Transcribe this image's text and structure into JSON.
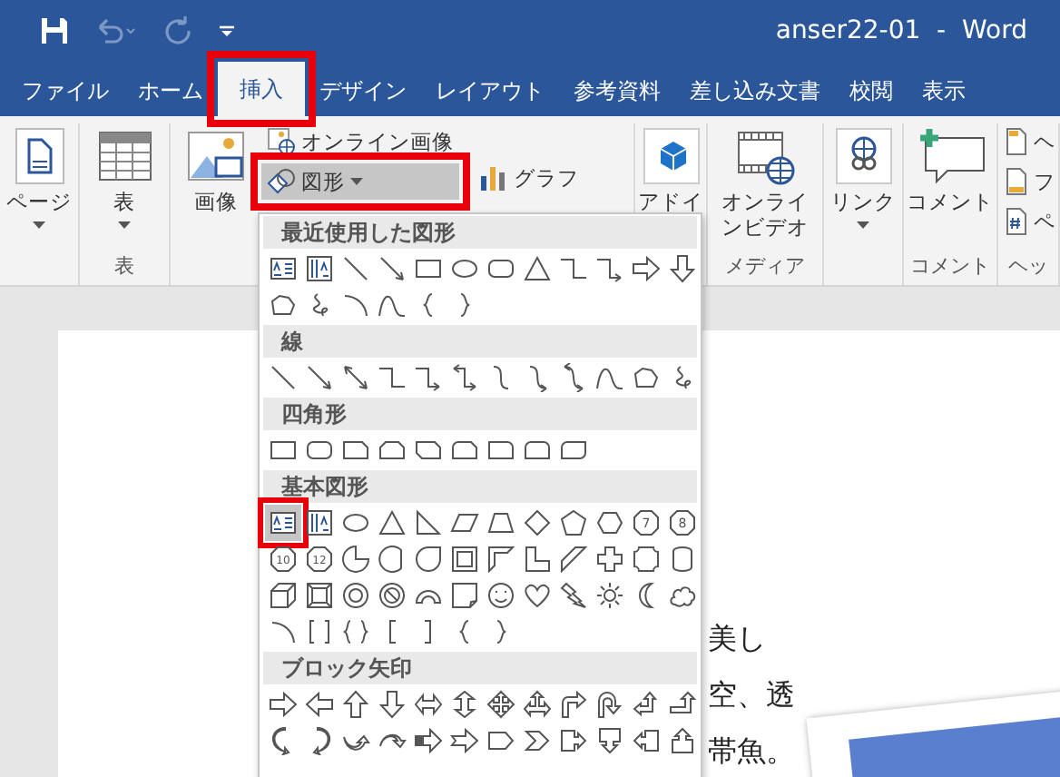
{
  "window": {
    "title": "anser22-01  -  Word"
  },
  "tabs": [
    {
      "label": "ファイル",
      "selected": false
    },
    {
      "label": "ホーム",
      "selected": false
    },
    {
      "label": "挿入",
      "selected": true
    },
    {
      "label": "デザイン",
      "selected": false
    },
    {
      "label": "レイアウト",
      "selected": false
    },
    {
      "label": "参考資料",
      "selected": false
    },
    {
      "label": "差し込み文書",
      "selected": false
    },
    {
      "label": "校閲",
      "selected": false
    },
    {
      "label": "表示",
      "selected": false
    }
  ],
  "ribbon": {
    "groups": [
      {
        "columns": [
          [
            {
              "kind": "page",
              "label": "ページ",
              "caret": true,
              "expanded": false
            }
          ]
        ]
      },
      {
        "label": "表",
        "columns": [
          [
            {
              "kind": "table",
              "label": "表",
              "caret": true,
              "expanded": false
            }
          ]
        ]
      },
      {
        "columns": [
          [
            {
              "kind": "picture",
              "label": "画像",
              "caret": false,
              "expanded": false
            }
          ],
          [
            {
              "kind": "online-picture",
              "label": "オンライン画像",
              "caret": false,
              "expanded": false
            },
            {
              "kind": "shapes",
              "label": "図形",
              "caret": true,
              "expanded": true
            }
          ],
          [
            {
              "kind": "chart",
              "label": "グラフ",
              "caret": false,
              "expanded": false
            }
          ]
        ]
      },
      {
        "columns": [
          [
            {
              "kind": "addin",
              "label": "アドイ",
              "caret": false,
              "expanded": false
            }
          ]
        ]
      },
      {
        "label": "メディア",
        "columns": [
          [
            {
              "kind": "video",
              "label": "オンラインビデオ",
              "caret": false,
              "expanded": false
            }
          ]
        ]
      },
      {
        "columns": [
          [
            {
              "kind": "link",
              "label": "リンク",
              "caret": true,
              "expanded": false
            }
          ]
        ]
      },
      {
        "label": "コメント",
        "columns": [
          [
            {
              "kind": "comment",
              "label": "コメント",
              "caret": false,
              "expanded": false
            }
          ]
        ]
      },
      {
        "label": "ヘッ",
        "columns": [
          [
            {
              "kind": "header",
              "label": "ヘ",
              "caret": false,
              "expanded": false
            },
            {
              "kind": "footer",
              "label": "フ",
              "caret": false,
              "expanded": false
            },
            {
              "kind": "number",
              "label": "ペ",
              "caret": false,
              "expanded": false
            }
          ]
        ]
      }
    ]
  },
  "shapes_menu": {
    "sections": [
      {
        "title": "最近使用した図形",
        "shapes": [
          {
            "kind": "text-box",
            "selected": false
          },
          {
            "kind": "vertical-text-box",
            "selected": false
          },
          {
            "kind": "line",
            "selected": false
          },
          {
            "kind": "arrow-line",
            "selected": false
          },
          {
            "kind": "rectangle",
            "selected": false
          },
          {
            "kind": "oval",
            "selected": false
          },
          {
            "kind": "rounded-rectangle",
            "selected": false
          },
          {
            "kind": "triangle",
            "selected": false
          },
          {
            "kind": "elbow-connector",
            "selected": false
          },
          {
            "kind": "elbow-arrow",
            "selected": false
          },
          {
            "kind": "right-arrow",
            "selected": false
          },
          {
            "kind": "down-arrow",
            "selected": false
          },
          {
            "kind": "freeform",
            "selected": false
          },
          {
            "kind": "scribble",
            "selected": false
          },
          {
            "kind": "arc",
            "selected": false
          },
          {
            "kind": "curve",
            "selected": false
          },
          {
            "kind": "left-brace",
            "selected": false
          },
          {
            "kind": "right-brace",
            "selected": false
          }
        ]
      },
      {
        "title": "線",
        "shapes": [
          {
            "kind": "line",
            "selected": false
          },
          {
            "kind": "arrow-line",
            "selected": false
          },
          {
            "kind": "double-arrow-line",
            "selected": false
          },
          {
            "kind": "elbow-connector",
            "selected": false
          },
          {
            "kind": "elbow-arrow",
            "selected": false
          },
          {
            "kind": "elbow-double-arrow",
            "selected": false
          },
          {
            "kind": "curved-connector",
            "selected": false
          },
          {
            "kind": "curved-arrow",
            "selected": false
          },
          {
            "kind": "curved-double-arrow",
            "selected": false
          },
          {
            "kind": "curve",
            "selected": false
          },
          {
            "kind": "freeform",
            "selected": false
          },
          {
            "kind": "scribble",
            "selected": false
          }
        ]
      },
      {
        "title": "四角形",
        "shapes": [
          {
            "kind": "rectangle",
            "selected": false
          },
          {
            "kind": "rounded-rectangle",
            "selected": false
          },
          {
            "kind": "snip-corner-rectangle",
            "selected": false
          },
          {
            "kind": "snip-side-rectangle",
            "selected": false
          },
          {
            "kind": "snip-diagonal-rectangle",
            "selected": false
          },
          {
            "kind": "snip-round-rectangle",
            "selected": false
          },
          {
            "kind": "round-corner-rectangle",
            "selected": false
          },
          {
            "kind": "round-side-rectangle",
            "selected": false
          },
          {
            "kind": "round-diagonal-rectangle",
            "selected": false
          }
        ]
      },
      {
        "title": "基本図形",
        "shapes": [
          {
            "kind": "text-box",
            "selected": true
          },
          {
            "kind": "vertical-text-box",
            "selected": false
          },
          {
            "kind": "oval",
            "selected": false
          },
          {
            "kind": "triangle",
            "selected": false
          },
          {
            "kind": "right-triangle",
            "selected": false
          },
          {
            "kind": "parallelogram",
            "selected": false
          },
          {
            "kind": "trapezoid",
            "selected": false
          },
          {
            "kind": "diamond",
            "selected": false
          },
          {
            "kind": "pentagon",
            "selected": false
          },
          {
            "kind": "hexagon",
            "selected": false
          },
          {
            "kind": "heptagon",
            "label": "7",
            "selected": false
          },
          {
            "kind": "octagon",
            "label": "8",
            "selected": false
          },
          {
            "kind": "decagon",
            "label": "10",
            "selected": false
          },
          {
            "kind": "dodecagon",
            "label": "12",
            "selected": false
          },
          {
            "kind": "pie",
            "selected": false
          },
          {
            "kind": "chord",
            "selected": false
          },
          {
            "kind": "teardrop",
            "selected": false
          },
          {
            "kind": "frame",
            "selected": false
          },
          {
            "kind": "half-frame",
            "selected": false
          },
          {
            "kind": "l-shape",
            "selected": false
          },
          {
            "kind": "diagonal-stripe",
            "selected": false
          },
          {
            "kind": "cross",
            "selected": false
          },
          {
            "kind": "plaque",
            "selected": false
          },
          {
            "kind": "can",
            "selected": false
          },
          {
            "kind": "cube",
            "selected": false
          },
          {
            "kind": "bevel",
            "selected": false
          },
          {
            "kind": "donut",
            "selected": false
          },
          {
            "kind": "no-symbol",
            "selected": false
          },
          {
            "kind": "block-arc",
            "selected": false
          },
          {
            "kind": "folded-corner",
            "selected": false
          },
          {
            "kind": "smiley",
            "selected": false
          },
          {
            "kind": "heart",
            "selected": false
          },
          {
            "kind": "lightning",
            "selected": false
          },
          {
            "kind": "sun",
            "selected": false
          },
          {
            "kind": "moon",
            "selected": false
          },
          {
            "kind": "cloud",
            "selected": false
          },
          {
            "kind": "arc",
            "selected": false
          },
          {
            "kind": "bracket-pair",
            "selected": false
          },
          {
            "kind": "brace-pair",
            "selected": false
          },
          {
            "kind": "left-bracket",
            "selected": false
          },
          {
            "kind": "right-bracket",
            "selected": false
          },
          {
            "kind": "left-brace",
            "selected": false
          },
          {
            "kind": "right-brace",
            "selected": false
          }
        ]
      },
      {
        "title": "ブロック矢印",
        "shapes": [
          {
            "kind": "right-arrow",
            "selected": false
          },
          {
            "kind": "left-arrow",
            "selected": false
          },
          {
            "kind": "up-arrow",
            "selected": false
          },
          {
            "kind": "down-arrow",
            "selected": false
          },
          {
            "kind": "left-right-arrow",
            "selected": false
          },
          {
            "kind": "up-down-arrow",
            "selected": false
          },
          {
            "kind": "quad-arrow",
            "selected": false
          },
          {
            "kind": "left-right-up-arrow",
            "selected": false
          },
          {
            "kind": "bent-arrow",
            "selected": false
          },
          {
            "kind": "u-turn-arrow",
            "selected": false
          },
          {
            "kind": "left-up-arrow",
            "selected": false
          },
          {
            "kind": "bent-up-arrow",
            "selected": false
          },
          {
            "kind": "curved-right-arrow",
            "selected": false
          },
          {
            "kind": "curved-left-arrow",
            "selected": false
          },
          {
            "kind": "curved-up-arrow",
            "selected": false
          },
          {
            "kind": "curved-down-arrow",
            "selected": false
          },
          {
            "kind": "striped-right-arrow",
            "selected": false
          },
          {
            "kind": "notched-right-arrow",
            "selected": false
          },
          {
            "kind": "pentagon-arrow",
            "selected": false
          },
          {
            "kind": "chevron",
            "selected": false
          },
          {
            "kind": "right-arrow-callout",
            "selected": false
          },
          {
            "kind": "down-arrow-callout",
            "selected": false
          },
          {
            "kind": "left-arrow-callout",
            "selected": false
          },
          {
            "kind": "up-arrow-callout",
            "selected": false
          }
        ]
      }
    ]
  },
  "document": {
    "lines": [
      "美し",
      "空、透",
      "帯魚。"
    ]
  }
}
